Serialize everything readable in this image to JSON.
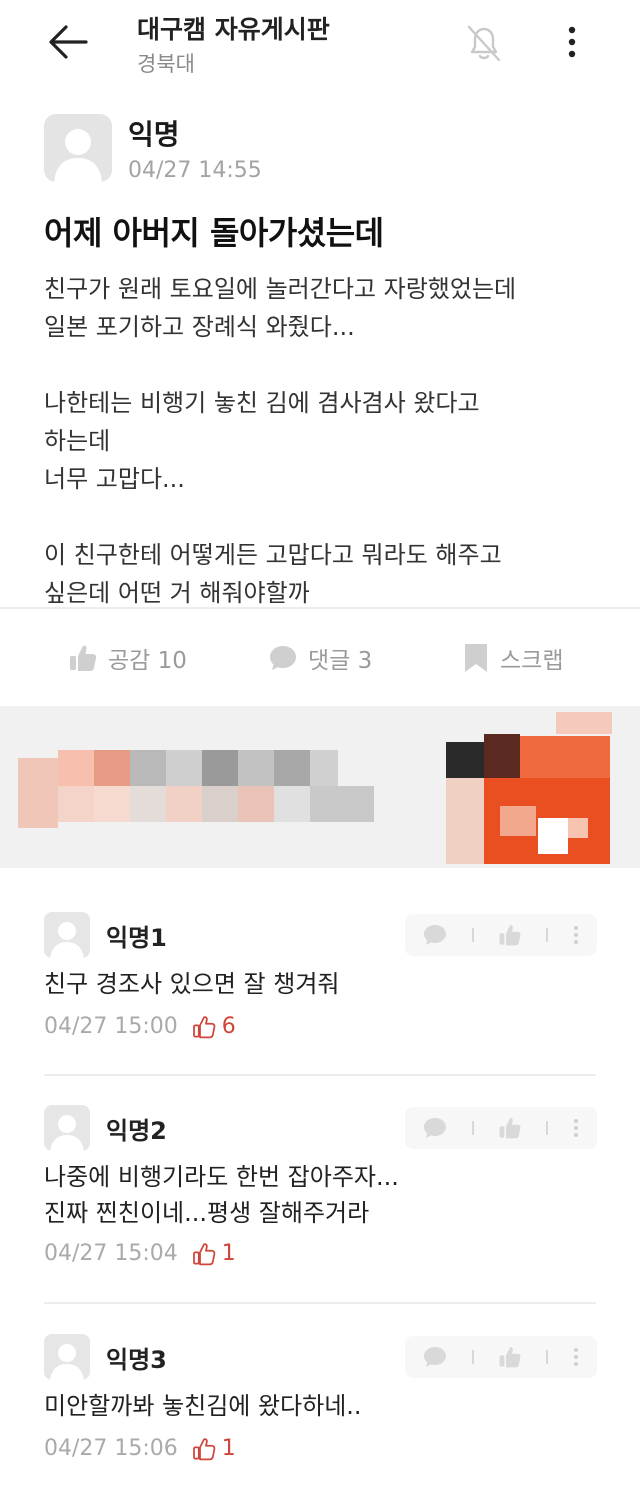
{
  "header": {
    "title": "대구캠 자유게시판",
    "subtitle": "경북대"
  },
  "post": {
    "author": "익명",
    "time": "04/27 14:55",
    "title": "어제 아버지 돌아가셨는데",
    "paragraphs": [
      "친구가 원래 토요일에 놀러간다고 자랑했었는데\n일본 포기하고 장례식 와줬다...",
      "나한테는 비행기 놓친 김에 겸사겸사 왔다고\n하는데\n너무 고맙다...",
      "이 친구한테 어떻게든 고맙다고 뭐라도 해주고\n싶은데 어떤 거 해줘야할까"
    ]
  },
  "actions": {
    "like_label": "공감 10",
    "comment_label": "댓글 3",
    "scrap_label": "스크랩"
  },
  "comments": [
    {
      "author": "익명1",
      "text": "친구 경조사 있으면 잘 챙겨줘",
      "time": "04/27 15:00",
      "likes": "6"
    },
    {
      "author": "익명2",
      "text": "나중에 비행기라도 한번 잡아주자...\n진짜 찐친이네...평생 잘해주거라",
      "time": "04/27 15:04",
      "likes": "1"
    },
    {
      "author": "익명3",
      "text": "미안할까봐 놓친김에 왔다하네..",
      "time": "04/27 15:06",
      "likes": "1"
    }
  ],
  "colors": {
    "accent_like": "#d0453a",
    "muted_text": "#9a9a9a",
    "ad_background": "#f1f1f1"
  },
  "icons": [
    "back-arrow-icon",
    "bell-off-icon",
    "more-vertical-icon",
    "thumbs-up-icon",
    "speech-bubble-icon",
    "bookmark-icon"
  ]
}
